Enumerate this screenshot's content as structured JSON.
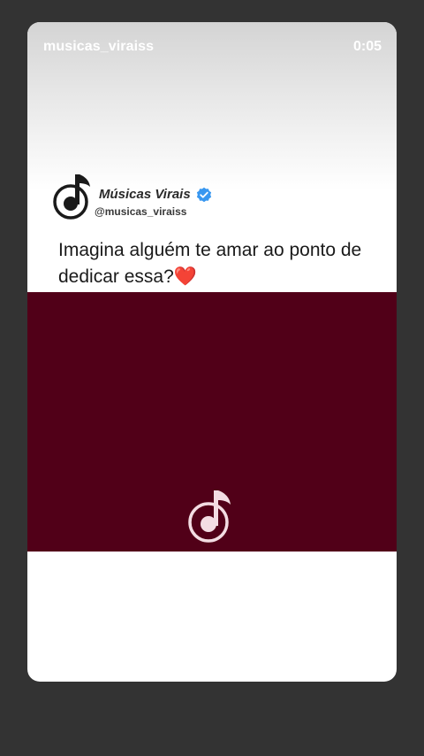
{
  "story": {
    "username": "musicas_viraiss",
    "elapsed": "0:05"
  },
  "post": {
    "display_name": "Músicas Virais",
    "handle": "@musicas_viraiss",
    "caption": "Imagina alguém te amar ao ponto de dedicar essa?",
    "caption_emoji": "❤️"
  },
  "colors": {
    "background": "#333333",
    "card": "#ffffff",
    "media": "#510018",
    "verified": "#3897f0"
  },
  "icons": {
    "logo": "music-note-circle-icon",
    "verified": "verified-badge-icon",
    "media_logo": "music-note-circle-icon"
  }
}
